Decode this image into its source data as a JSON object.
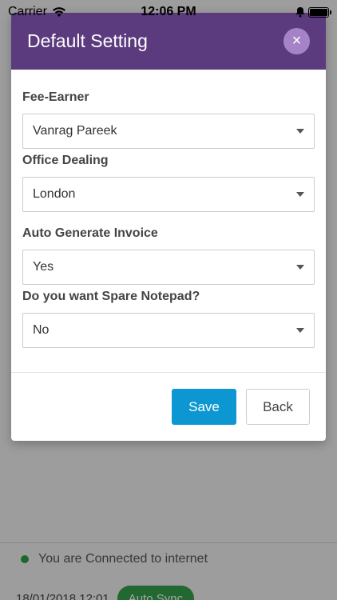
{
  "status_bar": {
    "carrier": "Carrier",
    "time": "12:06 PM"
  },
  "modal": {
    "title": "Default Setting",
    "close_label": "×",
    "fields": [
      {
        "label": "Fee-Earner",
        "value": "Vanrag Pareek"
      },
      {
        "label": "Office Dealing",
        "value": "London"
      },
      {
        "label": "Auto Generate Invoice",
        "value": "Yes"
      },
      {
        "label": "Do you want Spare Notepad?",
        "value": "No"
      }
    ],
    "save_label": "Save",
    "back_label": "Back"
  },
  "background": {
    "connection_text": "You are Connected to internet",
    "last_sync": "18/01/2018 12:01",
    "sync_label": "Auto Sync"
  },
  "colors": {
    "header": "#5b3a7e",
    "close_button": "#a583c6",
    "save_button": "#0c97d2",
    "connected_dot": "#2f9e44",
    "sync_button": "#35a04c"
  }
}
